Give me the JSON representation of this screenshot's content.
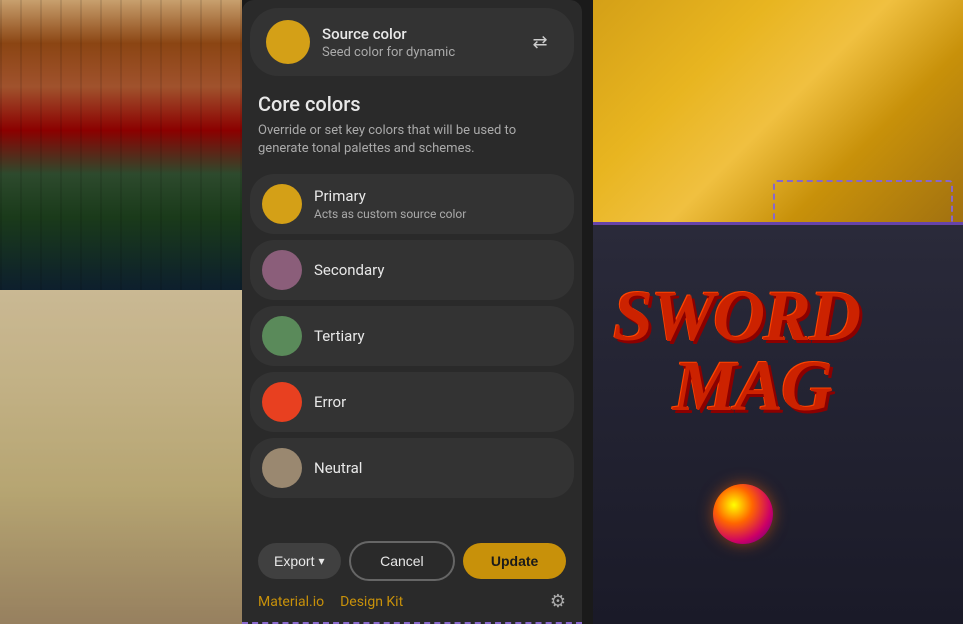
{
  "source_color": {
    "label": "Source color",
    "description": "Seed color for dynamic",
    "color": "#d4a017",
    "shuffle_icon": "⇄"
  },
  "core_colors": {
    "title": "Core colors",
    "description": "Override or set key colors that will be used to generate tonal palettes and schemes.",
    "items": [
      {
        "name": "Primary",
        "description": "Acts as custom source color",
        "color": "#d4a017"
      },
      {
        "name": "Secondary",
        "description": "",
        "color": "#8b5e7a"
      },
      {
        "name": "Tertiary",
        "description": "",
        "color": "#5a8a5a"
      },
      {
        "name": "Error",
        "description": "",
        "color": "#e84020"
      },
      {
        "name": "Neutral",
        "description": "",
        "color": "#9a8870"
      }
    ]
  },
  "actions": {
    "export_label": "Export",
    "cancel_label": "Cancel",
    "update_label": "Update",
    "chevron": "▾"
  },
  "footer": {
    "material_io": "Material.io",
    "design_kit": "Design Kit",
    "settings_icon": "⚙"
  }
}
